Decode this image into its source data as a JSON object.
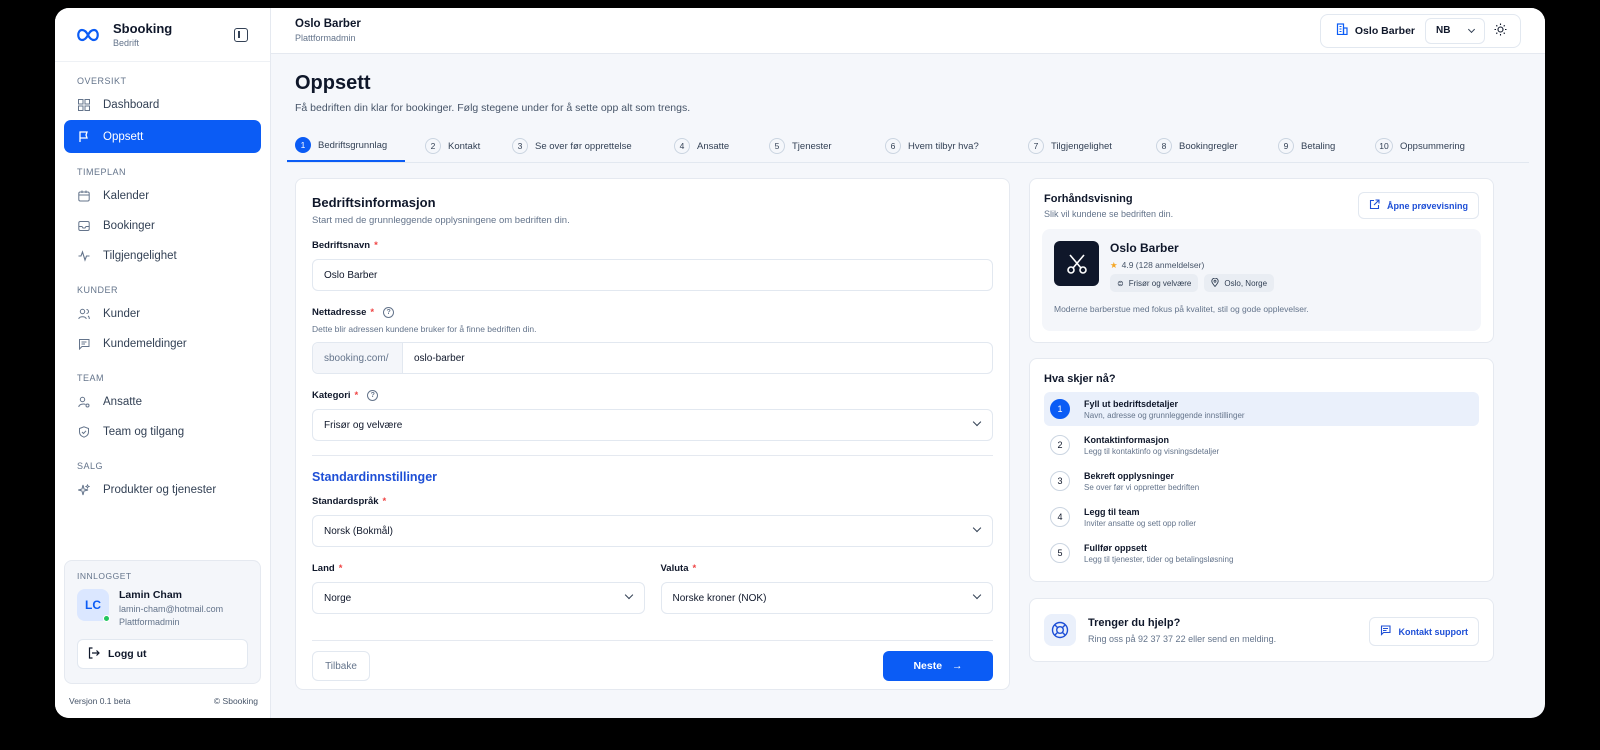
{
  "brand": {
    "name": "Sbooking",
    "subtitle": "Bedrift"
  },
  "sidebar": {
    "sections": [
      {
        "title": "OVERSIKT",
        "items": [
          {
            "label": "Dashboard",
            "icon": "grid-icon"
          },
          {
            "label": "Oppsett",
            "icon": "flag-icon",
            "active": true
          }
        ]
      },
      {
        "title": "TIMEPLAN",
        "items": [
          {
            "label": "Kalender",
            "icon": "calendar-icon"
          },
          {
            "label": "Bookinger",
            "icon": "inbox-icon"
          },
          {
            "label": "Tilgjengelighet",
            "icon": "activity-icon"
          }
        ]
      },
      {
        "title": "KUNDER",
        "items": [
          {
            "label": "Kunder",
            "icon": "users-icon"
          },
          {
            "label": "Kundemeldinger",
            "icon": "message-icon"
          }
        ]
      },
      {
        "title": "TEAM",
        "items": [
          {
            "label": "Ansatte",
            "icon": "user-cog-icon"
          },
          {
            "label": "Team og tilgang",
            "icon": "shield-icon"
          }
        ]
      },
      {
        "title": "SALG",
        "items": [
          {
            "label": "Produkter og tjenester",
            "icon": "sparkles-icon"
          }
        ]
      }
    ],
    "user": {
      "section_label": "INNLOGGET",
      "initials": "LC",
      "name": "Lamin Cham",
      "email": "lamin-cham@hotmail.com",
      "role": "Plattformadmin",
      "logout_label": "Logg ut"
    },
    "version": "Versjon 0.1 beta",
    "copyright": "© Sbooking"
  },
  "topbar": {
    "title": "Oslo Barber",
    "subtitle": "Plattformadmin",
    "org_label": "Oslo Barber",
    "lang": "NB"
  },
  "page": {
    "title": "Oppsett",
    "subtitle": "Få bedriften din klar for bookinger. Følg stegene under for å sette opp alt som trengs."
  },
  "steps": [
    {
      "num": "1",
      "label": "Bedriftsgrunnlag",
      "active": true
    },
    {
      "num": "2",
      "label": "Kontakt"
    },
    {
      "num": "3",
      "label": "Se over før opprettelse"
    },
    {
      "num": "4",
      "label": "Ansatte"
    },
    {
      "num": "5",
      "label": "Tjenester"
    },
    {
      "num": "6",
      "label": "Hvem tilbyr hva?"
    },
    {
      "num": "7",
      "label": "Tilgjengelighet"
    },
    {
      "num": "8",
      "label": "Bookingregler"
    },
    {
      "num": "9",
      "label": "Betaling"
    },
    {
      "num": "10",
      "label": "Oppsummering"
    }
  ],
  "form": {
    "title": "Bedriftsinformasjon",
    "description": "Start med de grunnleggende opplysningene om bedriften din.",
    "company_name_label": "Bedriftsnavn",
    "company_name_value": "Oslo Barber",
    "web_label": "Nettadresse",
    "web_hint": "Dette blir adressen kundene bruker for å finne bedriften din.",
    "web_prefix": "sbooking.com/",
    "web_value": "oslo-barber",
    "category_label": "Kategori",
    "category_value": "Frisør og velvære",
    "defaults_title": "Standardinnstillinger",
    "language_label": "Standardspråk",
    "language_value": "Norsk (Bokmål)",
    "country_label": "Land",
    "country_value": "Norge",
    "currency_label": "Valuta",
    "currency_value": "Norske kroner (NOK)",
    "back_label": "Tilbake",
    "next_label": "Neste"
  },
  "preview": {
    "title": "Forhåndsvisning",
    "subtitle": "Slik vil kundene se bedriften din.",
    "open_label": "Åpne prøvevisning",
    "name": "Oslo Barber",
    "rating": "4.9 (128 anmeldelser)",
    "category": "Frisør og velvære",
    "location": "Oslo, Norge",
    "description": "Moderne barberstue med fokus på kvalitet, stil og gode opplevelser."
  },
  "next_steps": {
    "title": "Hva skjer nå?",
    "items": [
      {
        "num": "1",
        "title": "Fyll ut bedriftsdetaljer",
        "desc": "Navn, adresse og grunnleggende innstillinger",
        "active": true
      },
      {
        "num": "2",
        "title": "Kontaktinformasjon",
        "desc": "Legg til kontaktinfo og visningsdetaljer"
      },
      {
        "num": "3",
        "title": "Bekreft opplysninger",
        "desc": "Se over før vi oppretter bedriften"
      },
      {
        "num": "4",
        "title": "Legg til team",
        "desc": "Inviter ansatte og sett opp roller"
      },
      {
        "num": "5",
        "title": "Fullfør oppsett",
        "desc": "Legg til tjenester, tider og betalingsløsning"
      }
    ]
  },
  "help": {
    "title": "Trenger du hjelp?",
    "desc": "Ring oss på 92 37 37 22 eller send en melding.",
    "button_label": "Kontakt support"
  },
  "colors": {
    "accent": "#0b5cf5",
    "required": "#ef4444",
    "section_heading": "#1e4fd6"
  }
}
